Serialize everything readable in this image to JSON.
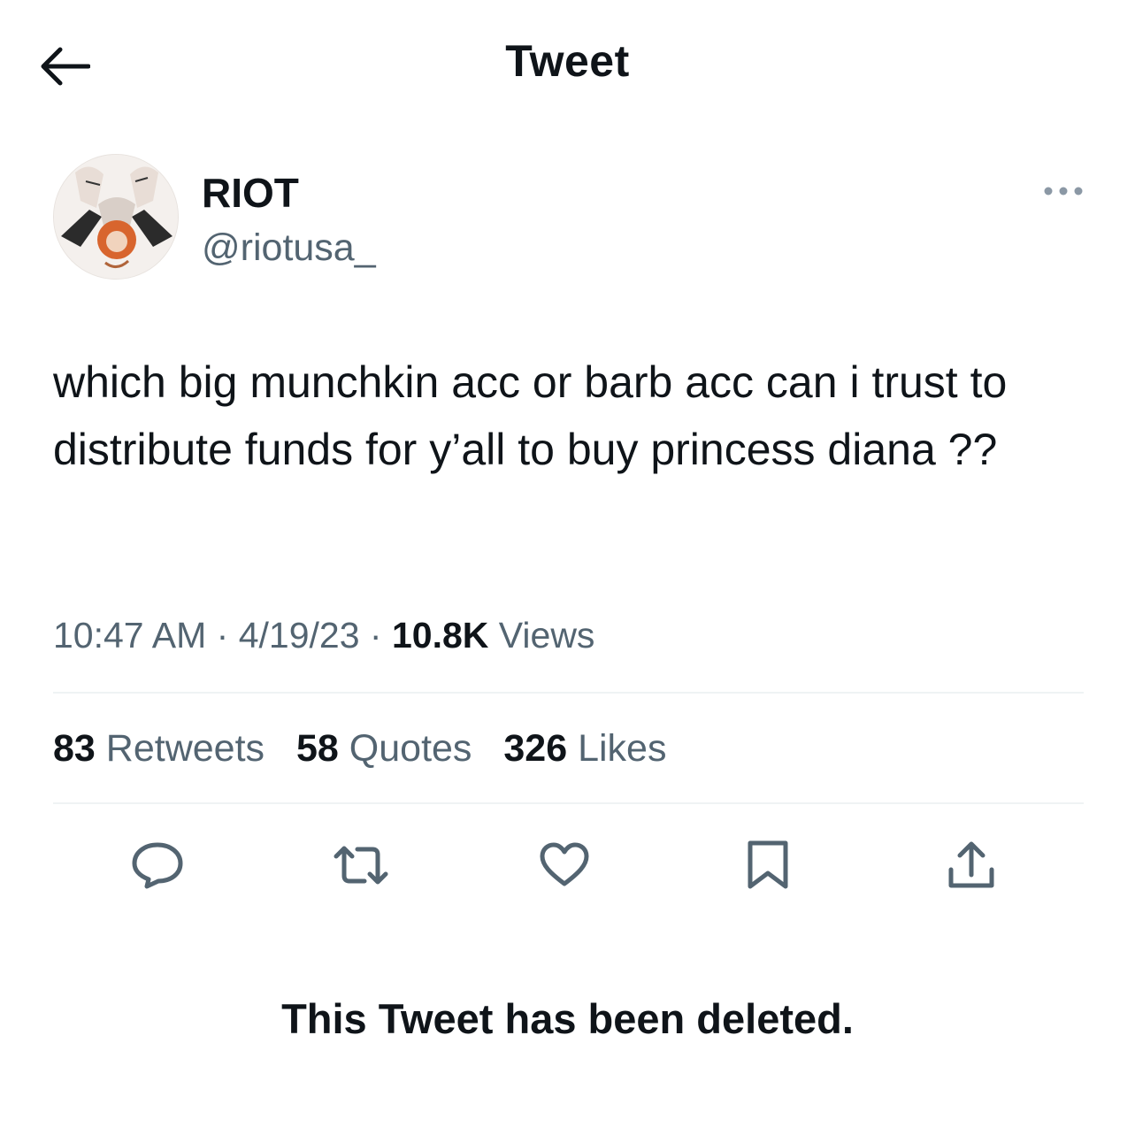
{
  "header": {
    "title": "Tweet",
    "back_icon": "arrow-left-icon"
  },
  "author": {
    "display_name": "RIOT",
    "handle": "@riotusa_",
    "avatar": "avatar-image",
    "more_icon": "more-dots-icon"
  },
  "tweet": {
    "text": "which big munchkin acc or barb acc can i trust to distribute funds for y’all to buy princess diana ??",
    "time": "10:47 AM",
    "separator": "·",
    "date": "4/19/23",
    "views_count": "10.8K",
    "views_label": "Views"
  },
  "stats": {
    "retweets_count": "83",
    "retweets_label": "Retweets",
    "quotes_count": "58",
    "quotes_label": "Quotes",
    "likes_count": "326",
    "likes_label": "Likes"
  },
  "actions": {
    "reply_icon": "reply-icon",
    "retweet_icon": "retweet-icon",
    "like_icon": "heart-icon",
    "bookmark_icon": "bookmark-icon",
    "share_icon": "share-icon"
  },
  "footer": {
    "deleted_notice": "This Tweet has been deleted."
  },
  "colors": {
    "text_primary": "#0f1419",
    "text_secondary": "#536471",
    "divider": "#eff3f4",
    "icon": "#536471"
  }
}
